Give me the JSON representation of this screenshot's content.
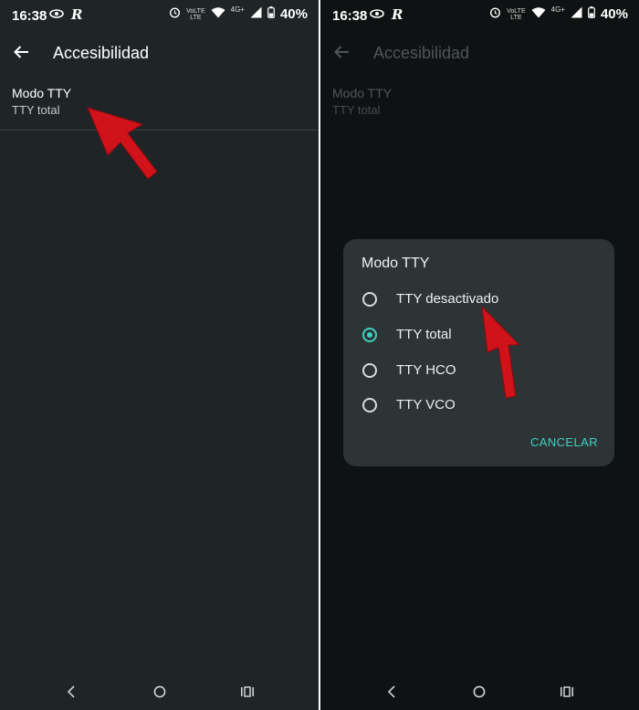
{
  "colors": {
    "accent": "#3fd0c0",
    "annotation": "#d0121b"
  },
  "left": {
    "status": {
      "time": "16:38",
      "network": "4G+",
      "volte_top": "VoLTE",
      "volte_bottom": "LTE",
      "battery": "40%"
    },
    "app_bar": {
      "title": "Accesibilidad",
      "back_icon": "arrow-back-icon"
    },
    "preference": {
      "title": "Modo TTY",
      "summary": "TTY total"
    }
  },
  "right": {
    "status": {
      "time": "16:38",
      "network": "4G+",
      "volte_top": "VoLTE",
      "volte_bottom": "LTE",
      "battery": "40%"
    },
    "app_bar": {
      "title": "Accesibilidad",
      "back_icon": "arrow-back-icon"
    },
    "preference": {
      "title": "Modo TTY",
      "summary": "TTY total"
    },
    "dialog": {
      "title": "Modo TTY",
      "options": [
        {
          "label": "TTY desactivado",
          "checked": false
        },
        {
          "label": "TTY total",
          "checked": true
        },
        {
          "label": "TTY HCO",
          "checked": false
        },
        {
          "label": "TTY VCO",
          "checked": false
        }
      ],
      "cancel_label": "CANCELAR"
    }
  }
}
